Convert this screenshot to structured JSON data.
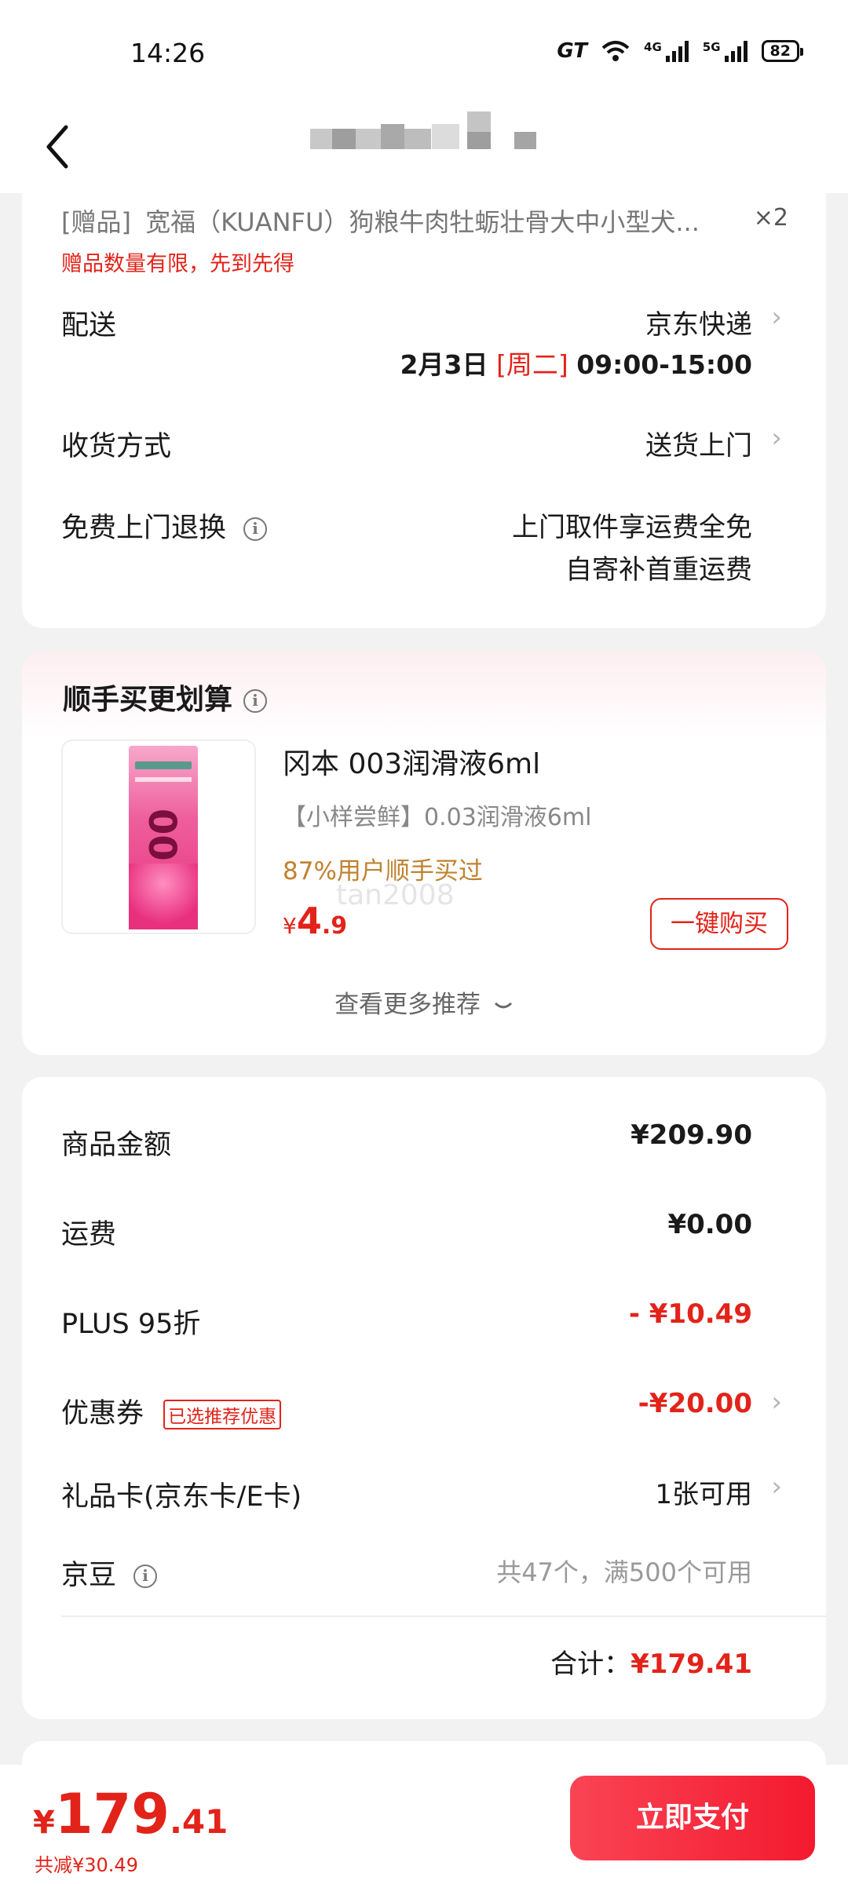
{
  "status_bar": {
    "time": "14:26",
    "gt": "GT",
    "net1": "4G",
    "net2": "5G",
    "battery": "82"
  },
  "gift": {
    "tag": "[赠品]",
    "name": "宽福（KUANFU）狗粮牛肉牡蛎壮骨大中小型犬...",
    "qty": "×2",
    "notice": "赠品数量有限，先到先得"
  },
  "delivery": {
    "label": "配送",
    "carrier": "京东快递",
    "date": "2月3日",
    "weekday": "[周二]",
    "time_window": "09:00-15:00",
    "method_label": "收货方式",
    "method_value": "送货上门",
    "return_label": "免费上门退换",
    "return_line1": "上门取件享运费全免",
    "return_line2": "自寄补首重运费"
  },
  "recommend": {
    "title": "顺手买更划算",
    "product_name": "冈本 003润滑液6ml",
    "product_sub": "【小样尝鲜】0.03润滑液6ml",
    "social_proof": "87%用户顺手买过",
    "price_symbol": "¥",
    "price_int": "4",
    "price_dec": ".9",
    "buy_button": "一键购买",
    "more": "查看更多推荐",
    "watermark": "tan2008",
    "image_text": "003"
  },
  "summary": {
    "goods_label": "商品金额",
    "goods_value": "¥209.90",
    "shipping_label": "运费",
    "shipping_value": "¥0.00",
    "plus_label": "PLUS 95折",
    "plus_value": "- ¥10.49",
    "coupon_label": "优惠券",
    "coupon_badge": "已选推荐优惠",
    "coupon_value": "-¥20.00",
    "giftcard_label": "礼品卡(京东卡/E卡)",
    "giftcard_value": "1张可用",
    "beans_label": "京豆",
    "beans_value": "共47个，满500个可用",
    "total_label": "合计：",
    "total_value": "¥179.41"
  },
  "bottom_bar": {
    "symbol": "¥",
    "amount_int": "179",
    "amount_dec": ".41",
    "saved": "共减¥30.49",
    "pay_button": "立即支付"
  },
  "colors": {
    "accent": "#e2231a",
    "pay_button": "#f41a2e",
    "gold": "#c0822f"
  }
}
